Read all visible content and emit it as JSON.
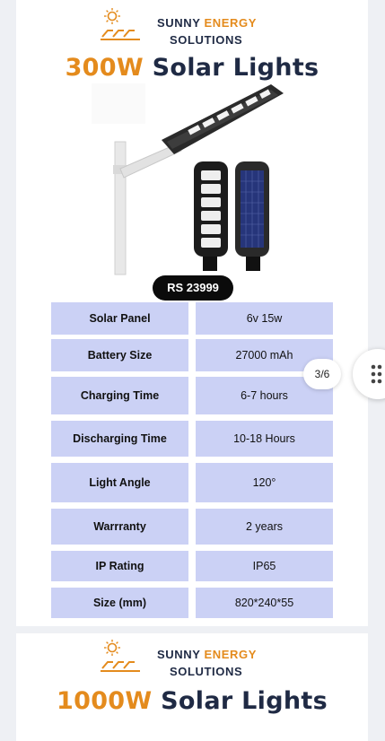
{
  "colors": {
    "accent": "#e48b1d",
    "navy": "#1f2a44",
    "spec_cell": "#cbd1f5",
    "price_pill": "#0b0b0b"
  },
  "brand": {
    "line1_word1": "SUNNY",
    "line1_word2": "ENERGY",
    "line2": "SOLUTIONS"
  },
  "card1": {
    "title_wattage": "300W",
    "title_word1": "Solar",
    "title_word2": "Lights",
    "price": "RS 23999",
    "specs": [
      {
        "label": "Solar Panel",
        "value": "6v 15w"
      },
      {
        "label": "Battery Size",
        "value": "27000 mAh"
      },
      {
        "label": "Charging Time",
        "value": "6-7 hours"
      },
      {
        "label": "Discharging Time",
        "value": "10-18 Hours"
      },
      {
        "label": "Light Angle",
        "value": "120°"
      },
      {
        "label": "Warrranty",
        "value": "2 years"
      },
      {
        "label": "IP Rating",
        "value": "IP65"
      },
      {
        "label": "Size (mm)",
        "value": "820*240*55"
      }
    ]
  },
  "card2": {
    "title_wattage": "1000W",
    "title_word1": "Solar",
    "title_word2": "Lights"
  },
  "gallery": {
    "counter": "3/6",
    "grid_icon": "grid-dots-icon"
  }
}
